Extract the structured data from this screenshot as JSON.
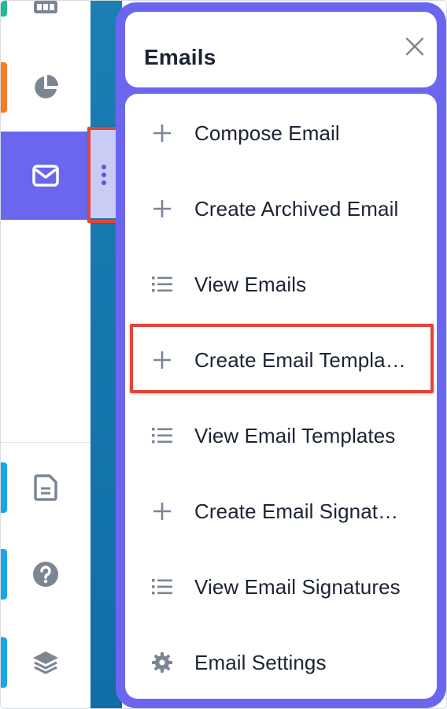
{
  "panel": {
    "title": "Emails",
    "close_label": "close"
  },
  "menu": {
    "items": [
      {
        "label": "Compose Email",
        "icon": "plus-icon"
      },
      {
        "label": "Create Archived Email",
        "icon": "plus-icon"
      },
      {
        "label": "View Emails",
        "icon": "list-icon"
      },
      {
        "label": "Create Email Templa…",
        "icon": "plus-icon",
        "highlighted": true
      },
      {
        "label": "View Email Templates",
        "icon": "list-icon"
      },
      {
        "label": "Create Email Signat…",
        "icon": "plus-icon"
      },
      {
        "label": "View Email Signatures",
        "icon": "list-icon"
      },
      {
        "label": "Email Settings",
        "icon": "gear-icon"
      }
    ]
  },
  "rail": {
    "items": [
      {
        "icon": "grid-icon",
        "accent": "#1fb89a"
      },
      {
        "icon": "pie-chart-icon",
        "accent": "#f57c23"
      },
      {
        "icon": "envelope-icon",
        "active": true
      },
      {
        "icon": "document-icon",
        "accent": "#1aa6e6"
      },
      {
        "icon": "help-icon",
        "accent": "#1aa6e6"
      },
      {
        "icon": "layers-icon",
        "accent": "#1aa6e6"
      }
    ]
  },
  "colors": {
    "panel_bg": "#6b66f0",
    "active_rail": "#6b66f0",
    "highlight_border": "#e0463a",
    "strip": "#1677ad",
    "icon_gray": "#7c8594",
    "text": "#1c2434"
  }
}
